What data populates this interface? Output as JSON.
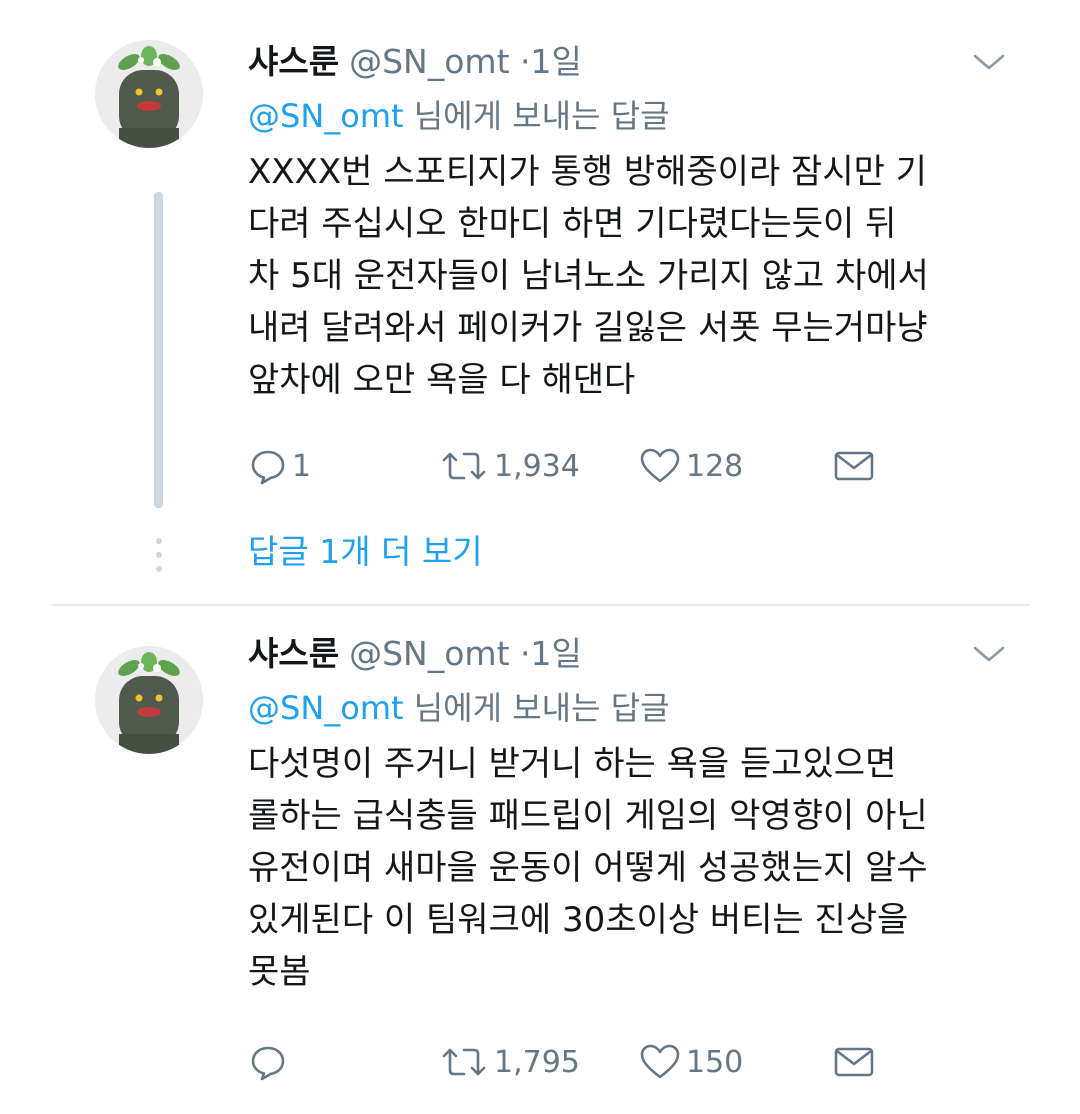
{
  "tweets": [
    {
      "name": "샤스룬",
      "handle": "@SN_omt",
      "separator": "·",
      "time": "1일",
      "reply_mention": "@SN_omt",
      "reply_text": " 님에게 보내는 답글",
      "lines": [
        "XXXX번 스포티지가 통행 방해중이라 잠시만 기",
        "다려 주십시오 한마디 하면 기다렸다는듯이 뒤",
        "차 5대 운전자들이 남녀노소 가리지 않고 차에서",
        "내려 달려와서 페이커가 길잃은 서폿 무는거마냥",
        "앞차에 오만 욕을 다 해댄다"
      ],
      "reply_count": "1",
      "retweet_count": "1,934",
      "like_count": "128"
    },
    {
      "name": "샤스룬",
      "handle": "@SN_omt",
      "separator": "·",
      "time": "1일",
      "reply_mention": "@SN_omt",
      "reply_text": " 님에게 보내는 답글",
      "lines": [
        "다섯명이 주거니 받거니 하는 욕을 듣고있으면",
        "롤하는 급식충들 패드립이 게임의 악영향이 아닌",
        "유전이며 새마을 운동이 어떻게 성공했는지 알수",
        "있게된다 이 팀워크에 30초이상 버티는 진상을",
        "못봄"
      ],
      "reply_count": "",
      "retweet_count": "1,795",
      "like_count": "150"
    }
  ],
  "more_replies_label": "답글 1개 더 보기",
  "icons": {
    "reply": "speech-bubble-icon",
    "retweet": "retweet-icon",
    "like": "heart-icon",
    "dm": "envelope-icon",
    "menu": "chevron-down-icon"
  },
  "colors": {
    "accent": "#1da1f2",
    "secondary_text": "#657786",
    "primary_text": "#14171a",
    "thread_line": "#cdd7e1"
  }
}
